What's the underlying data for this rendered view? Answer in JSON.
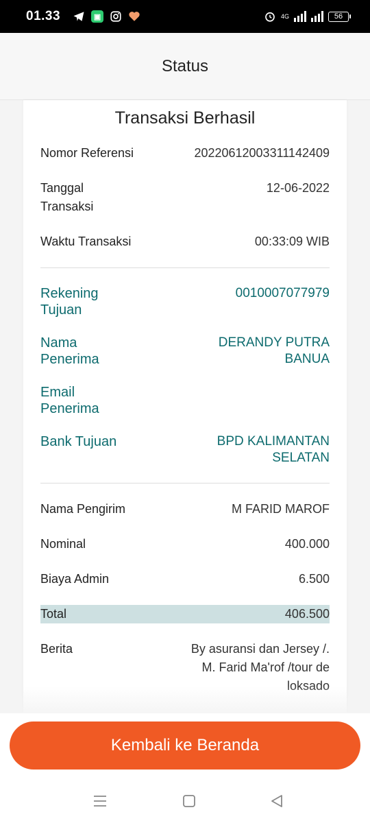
{
  "status_bar": {
    "time": "01.33",
    "network": "4G",
    "battery": "56"
  },
  "header": {
    "title": "Status"
  },
  "receipt": {
    "title": "Transaksi Berhasil",
    "reference": {
      "label": "Nomor Referensi",
      "value": "20220612003311142409"
    },
    "date": {
      "label_line1": "Tanggal",
      "label_line2": "Transaksi",
      "value": "12-06-2022"
    },
    "time": {
      "label": "Waktu Transaksi",
      "value": "00:33:09 WIB"
    },
    "destination_account": {
      "label_line1": "Rekening",
      "label_line2": "Tujuan",
      "value": "0010007077979"
    },
    "recipient_name": {
      "label_line1": "Nama",
      "label_line2": "Penerima",
      "value_line1": "DERANDY PUTRA",
      "value_line2": "BANUA"
    },
    "recipient_email": {
      "label_line1": "Email",
      "label_line2": "Penerima",
      "value": ""
    },
    "destination_bank": {
      "label": "Bank Tujuan",
      "value_line1": "BPD KALIMANTAN",
      "value_line2": "SELATAN"
    },
    "sender_name": {
      "label": "Nama Pengirim",
      "value": "M FARID MAROF"
    },
    "nominal": {
      "label": "Nominal",
      "value": "400.000"
    },
    "admin_fee": {
      "label": "Biaya Admin",
      "value": "6.500"
    },
    "total": {
      "label": "Total",
      "value": "406.500"
    },
    "message": {
      "label": "Berita",
      "value_line1": "By asuransi dan Jersey /.",
      "value_line2": "M. Farid Ma'rof /tour de",
      "value_line3": "loksado"
    }
  },
  "actions": {
    "home_button": "Kembali ke Beranda"
  },
  "nav": {
    "icons": [
      "menu-icon",
      "home-square-icon",
      "back-triangle-icon"
    ]
  },
  "colors": {
    "accent": "#f05a24",
    "teal": "#0d6b6e",
    "total_highlight": "#cde0e1"
  }
}
